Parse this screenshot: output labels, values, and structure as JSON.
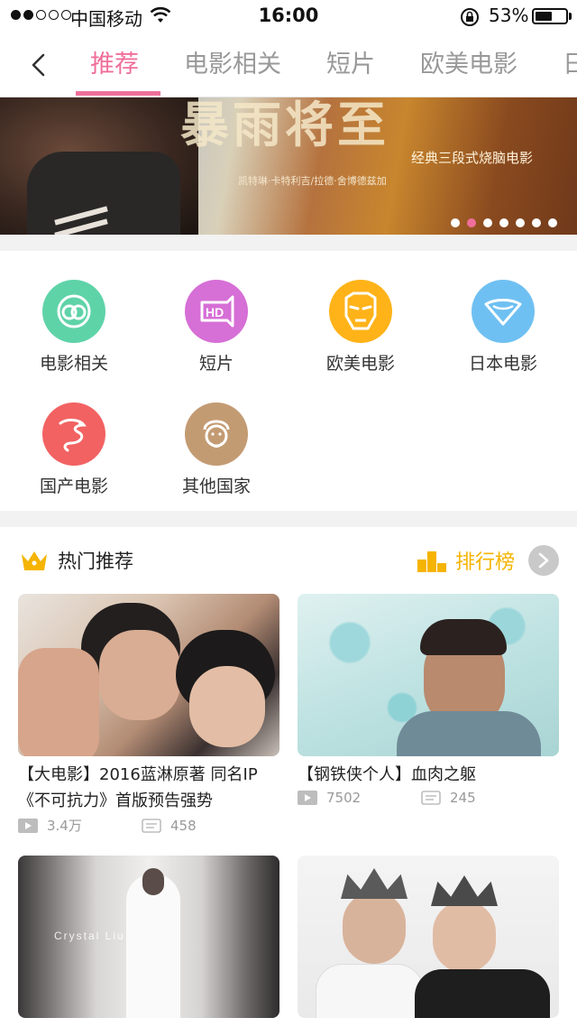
{
  "status_bar": {
    "carrier": "中国移动",
    "time": "16:00",
    "battery": "53%",
    "battery_level": 0.53
  },
  "nav": {
    "tabs": [
      {
        "label": "推荐",
        "active": true
      },
      {
        "label": "电影相关",
        "active": false
      },
      {
        "label": "短片",
        "active": false
      },
      {
        "label": "欧美电影",
        "active": false
      },
      {
        "label": "日",
        "active": false
      }
    ]
  },
  "banner": {
    "title": "暴雨将至",
    "subtitle": "经典三段式烧脑电影",
    "cast": "凯特琳·卡特利吉/拉德·舍博德兹加",
    "page_count": 7,
    "active_page": 1
  },
  "categories": [
    {
      "label": "电影相关",
      "icon": "rings-icon",
      "color": "#5fd3a8"
    },
    {
      "label": "短片",
      "icon": "hd-icon",
      "color": "#d66fd6"
    },
    {
      "label": "欧美电影",
      "icon": "iron-man-mask-icon",
      "color": "#ffb319"
    },
    {
      "label": "日本电影",
      "icon": "kerchief-icon",
      "color": "#6fc0f2"
    },
    {
      "label": "国产电影",
      "icon": "dragon-icon",
      "color": "#f26262"
    },
    {
      "label": "其他国家",
      "icon": "old-man-icon",
      "color": "#c39b73"
    }
  ],
  "section": {
    "title": "热门推荐",
    "ranking_label": "排行榜",
    "accent": "#f5b400"
  },
  "videos": [
    {
      "title": "【大电影】2016蓝淋原著 同名IP《不可抗力》首版预告强势",
      "plays": "3.4万",
      "comments": "458"
    },
    {
      "title": "【钢铁侠个人】血肉之躯",
      "plays": "7502",
      "comments": "245"
    },
    {
      "title": "",
      "plays": "",
      "comments": "",
      "watermark": "Crystal Liu"
    },
    {
      "title": "",
      "plays": "",
      "comments": ""
    }
  ],
  "colors": {
    "accent_pink": "#ef6f9a",
    "accent_gold": "#f5b400"
  }
}
